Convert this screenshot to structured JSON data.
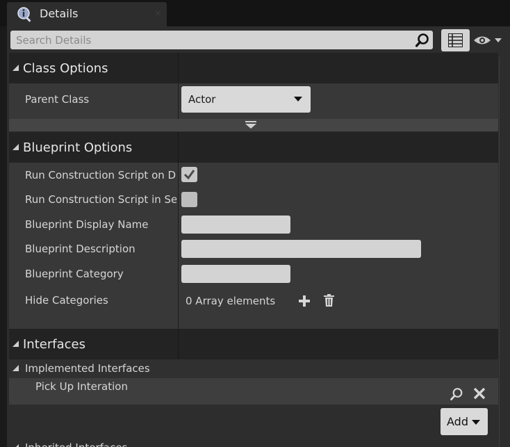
{
  "tab": {
    "title": "Details",
    "icon": "info-icon",
    "close": "×"
  },
  "search": {
    "placeholder": "Search Details"
  },
  "categories": {
    "class_options": {
      "title": "Class Options",
      "parent_class_label": "Parent Class",
      "parent_class_value": "Actor"
    },
    "blueprint_options": {
      "title": "Blueprint Options",
      "rows": {
        "run_on_drag": "Run Construction Script on Drag",
        "run_in_sequencer": "Run Construction Script in Sequencer",
        "display_name": "Blueprint Display Name",
        "description": "Blueprint Description",
        "category": "Blueprint Category",
        "hide_categories": "Hide Categories"
      },
      "run_on_drag_checked": true,
      "run_in_sequencer_checked": false,
      "display_name_value": "",
      "description_value": "",
      "category_value": "",
      "hide_categories_value": "0 Array elements"
    },
    "interfaces": {
      "title": "Interfaces",
      "implemented_label": "Implemented Interfaces",
      "implemented_items": [
        "Pick Up Interation"
      ],
      "add_label": "Add",
      "inherited_label": "Inherited Interfaces"
    }
  },
  "colors": {
    "panel": "#2d2d2d",
    "category_header": "#232323",
    "row_bg": "#383838",
    "field": "#d3d3d3"
  }
}
